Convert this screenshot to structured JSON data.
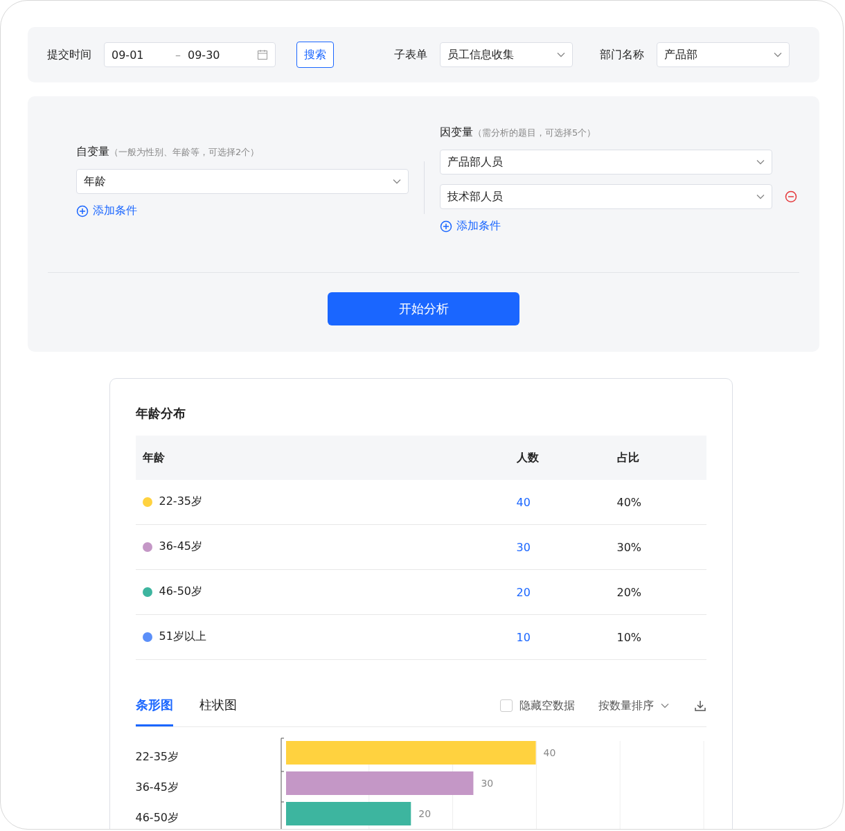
{
  "filters": {
    "date_label": "提交时间",
    "date_start": "09-01",
    "date_sep": "–",
    "date_end": "09-30",
    "search_button": "搜索",
    "subform_label": "子表单",
    "subform_value": "员工信息收集",
    "dept_label": "部门名称",
    "dept_value": "产品部"
  },
  "analysis": {
    "independent": {
      "title": "自变量",
      "hint": "（一般为性别、年龄等，可选择2个）",
      "selects": [
        {
          "value": "年龄",
          "removable": false
        }
      ],
      "add": "添加条件"
    },
    "dependent": {
      "title": "因变量",
      "hint": "（需分析的题目，可选择5个）",
      "selects": [
        {
          "value": "产品部人员",
          "removable": false
        },
        {
          "value": "技术部人员",
          "removable": true
        }
      ],
      "add": "添加条件"
    },
    "start_button": "开始分析"
  },
  "result": {
    "title": "年龄分布",
    "columns": [
      "年龄",
      "人数",
      "占比"
    ],
    "rows": [
      {
        "label": "22-35岁",
        "count": "40",
        "share": "40%",
        "color": "#ffd23f"
      },
      {
        "label": "36-45岁",
        "count": "30",
        "share": "30%",
        "color": "#c497c6"
      },
      {
        "label": "46-50岁",
        "count": "20",
        "share": "20%",
        "color": "#3db59f"
      },
      {
        "label": "51岁以上",
        "count": "10",
        "share": "10%",
        "color": "#5b8ff9"
      }
    ],
    "tabs": [
      {
        "label": "条形图",
        "selected": true
      },
      {
        "label": "柱状图",
        "selected": false
      }
    ],
    "hide_empty": {
      "label": "隐藏空数据",
      "checked": false
    },
    "sort": "按数量排序",
    "chart_data": {
      "type": "bar",
      "orientation": "horizontal",
      "categories": [
        "22-35岁",
        "36-45岁",
        "46-50岁"
      ],
      "values": [
        40,
        30,
        20
      ],
      "xlim": [
        0,
        67
      ],
      "data_labels": true
    }
  }
}
